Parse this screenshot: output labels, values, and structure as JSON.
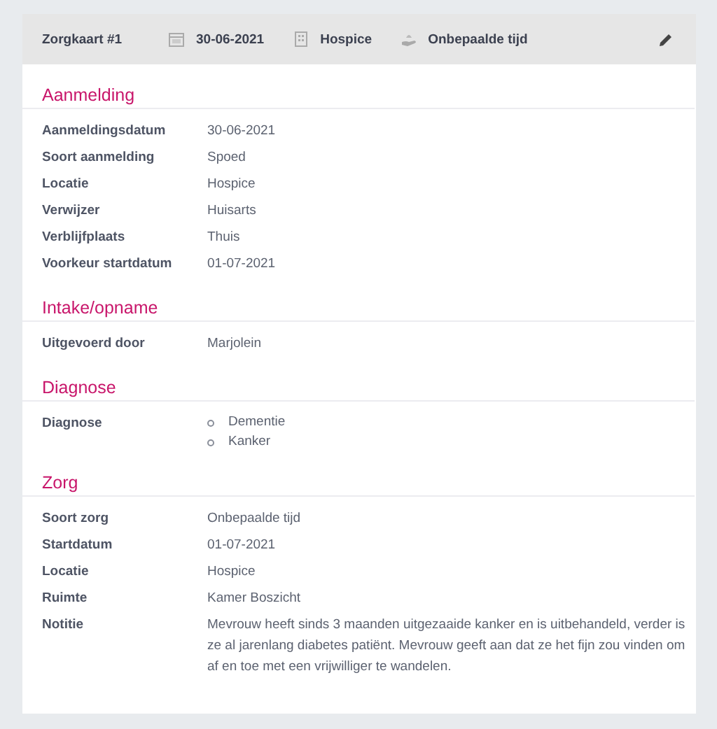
{
  "header": {
    "title": "Zorgkaart #1",
    "date": "30-06-2021",
    "location": "Hospice",
    "duration": "Onbepaalde tijd"
  },
  "sections": [
    {
      "title": "Aanmelding",
      "rows": [
        {
          "kind": "text",
          "label": "Aanmeldingsdatum",
          "value": "30-06-2021"
        },
        {
          "kind": "text",
          "label": "Soort aanmelding",
          "value": "Spoed"
        },
        {
          "kind": "text",
          "label": "Locatie",
          "value": "Hospice"
        },
        {
          "kind": "text",
          "label": "Verwijzer",
          "value": "Huisarts"
        },
        {
          "kind": "text",
          "label": "Verblijfplaats",
          "value": "Thuis"
        },
        {
          "kind": "text",
          "label": "Voorkeur startdatum",
          "value": "01-07-2021"
        }
      ]
    },
    {
      "title": "Intake/opname",
      "rows": [
        {
          "kind": "text",
          "label": "Uitgevoerd door",
          "value": "Marjolein"
        }
      ]
    },
    {
      "title": "Diagnose",
      "rows": [
        {
          "kind": "list",
          "label": "Diagnose",
          "items": [
            "Dementie",
            "Kanker"
          ]
        }
      ]
    },
    {
      "title": "Zorg",
      "rows": [
        {
          "kind": "text",
          "label": "Soort zorg",
          "value": "Onbepaalde tijd"
        },
        {
          "kind": "text",
          "label": "Startdatum",
          "value": "01-07-2021"
        },
        {
          "kind": "text",
          "label": "Locatie",
          "value": "Hospice"
        },
        {
          "kind": "text",
          "label": "Ruimte",
          "value": "Kamer Boszicht"
        },
        {
          "kind": "text",
          "label": "Notitie",
          "value": "Mevrouw heeft sinds 3 maanden uitgezaaide kanker en is uitbehandeld, verder is ze al jarenlang diabetes patiënt. Mevrouw geeft aan dat ze het fijn zou vinden om af en toe met een vrijwilliger te wandelen."
        }
      ]
    }
  ]
}
